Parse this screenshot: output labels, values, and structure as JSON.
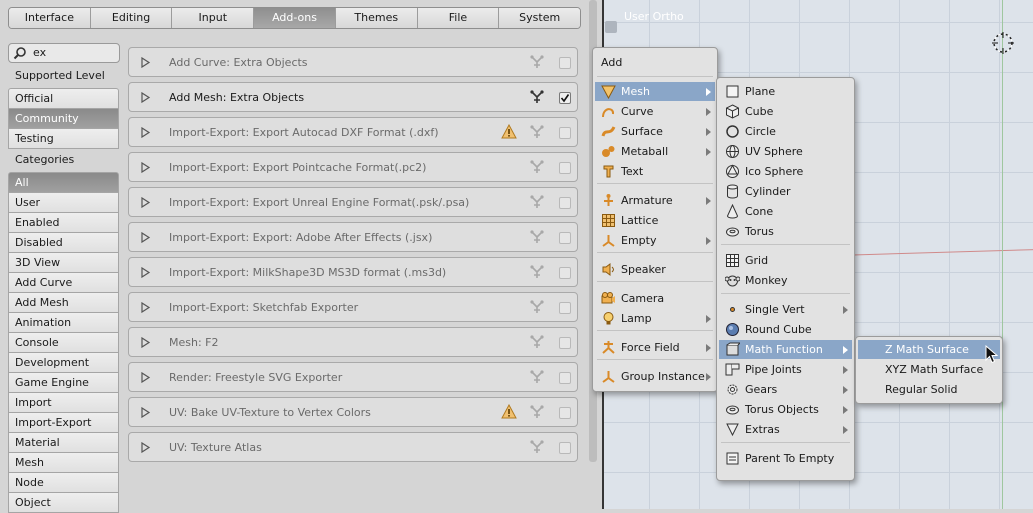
{
  "tabs": [
    "Interface",
    "Editing",
    "Input",
    "Add-ons",
    "Themes",
    "File",
    "System"
  ],
  "active_tab": "Add-ons",
  "search": {
    "value": "ex"
  },
  "supported_level": {
    "label": "Supported Level",
    "items": [
      "Official",
      "Community",
      "Testing"
    ],
    "selected": "Community"
  },
  "categories": {
    "label": "Categories",
    "items": [
      "All",
      "User",
      "Enabled",
      "Disabled",
      "3D View",
      "Add Curve",
      "Add Mesh",
      "Animation",
      "Console",
      "Development",
      "Game Engine",
      "Import",
      "Import-Export",
      "Material",
      "Mesh",
      "Node",
      "Object"
    ],
    "selected": "All"
  },
  "addons": [
    {
      "name": "Add Curve: Extra Objects",
      "enabled": false,
      "warning": false
    },
    {
      "name": "Add Mesh: Extra Objects",
      "enabled": true,
      "warning": false
    },
    {
      "name": "Import-Export: Export Autocad DXF Format (.dxf)",
      "enabled": false,
      "warning": true
    },
    {
      "name": "Import-Export: Export Pointcache Format(.pc2)",
      "enabled": false,
      "warning": false
    },
    {
      "name": "Import-Export: Export Unreal Engine Format(.psk/.psa)",
      "enabled": false,
      "warning": false
    },
    {
      "name": "Import-Export: Export: Adobe After Effects (.jsx)",
      "enabled": false,
      "warning": false
    },
    {
      "name": "Import-Export: MilkShape3D MS3D format (.ms3d)",
      "enabled": false,
      "warning": false
    },
    {
      "name": "Import-Export: Sketchfab Exporter",
      "enabled": false,
      "warning": false
    },
    {
      "name": "Mesh: F2",
      "enabled": false,
      "warning": false
    },
    {
      "name": "Render: Freestyle SVG Exporter",
      "enabled": false,
      "warning": false
    },
    {
      "name": "UV: Bake UV-Texture to Vertex Colors",
      "enabled": false,
      "warning": true
    },
    {
      "name": "UV: Texture Atlas",
      "enabled": false,
      "warning": false
    }
  ],
  "viewport": {
    "title": "User Ortho"
  },
  "add_menu": {
    "title": "Add",
    "items": [
      {
        "label": "Mesh",
        "icon": "mesh-icon",
        "submenu": true,
        "highlight": true
      },
      {
        "label": "Curve",
        "icon": "curve-icon",
        "submenu": true
      },
      {
        "label": "Surface",
        "icon": "surface-icon",
        "submenu": true
      },
      {
        "label": "Metaball",
        "icon": "metaball-icon",
        "submenu": true
      },
      {
        "label": "Text",
        "icon": "text-icon",
        "submenu": false
      },
      {
        "label": "Armature",
        "icon": "armature-icon",
        "submenu": true
      },
      {
        "label": "Lattice",
        "icon": "lattice-icon",
        "submenu": false
      },
      {
        "label": "Empty",
        "icon": "empty-icon",
        "submenu": true
      },
      {
        "label": "Speaker",
        "icon": "speaker-icon",
        "submenu": false
      },
      {
        "label": "Camera",
        "icon": "camera-icon",
        "submenu": false
      },
      {
        "label": "Lamp",
        "icon": "lamp-icon",
        "submenu": true
      },
      {
        "label": "Force Field",
        "icon": "force-field-icon",
        "submenu": true
      },
      {
        "label": "Group Instance",
        "icon": "group-instance-icon",
        "submenu": true
      }
    ]
  },
  "mesh_menu": {
    "items": [
      {
        "label": "Plane",
        "icon": "plane-icon"
      },
      {
        "label": "Cube",
        "icon": "cube-icon"
      },
      {
        "label": "Circle",
        "icon": "circle-icon"
      },
      {
        "label": "UV Sphere",
        "icon": "uv-sphere-icon"
      },
      {
        "label": "Ico Sphere",
        "icon": "ico-sphere-icon"
      },
      {
        "label": "Cylinder",
        "icon": "cylinder-icon"
      },
      {
        "label": "Cone",
        "icon": "cone-icon"
      },
      {
        "label": "Torus",
        "icon": "torus-icon"
      },
      {
        "label": "Grid",
        "icon": "grid-icon"
      },
      {
        "label": "Monkey",
        "icon": "monkey-icon"
      },
      {
        "label": "Single Vert",
        "icon": "vertex-icon",
        "submenu": true
      },
      {
        "label": "Round Cube",
        "icon": "round-cube-icon"
      },
      {
        "label": "Math Function",
        "icon": "math-function-icon",
        "submenu": true,
        "highlight": true
      },
      {
        "label": "Pipe Joints",
        "icon": "pipe-joints-icon",
        "submenu": true
      },
      {
        "label": "Gears",
        "icon": "gears-icon",
        "submenu": true
      },
      {
        "label": "Torus Objects",
        "icon": "torus-objects-icon",
        "submenu": true
      },
      {
        "label": "Extras",
        "icon": "extras-icon",
        "submenu": true
      },
      {
        "label": "Parent To Empty",
        "icon": "parent-icon"
      }
    ]
  },
  "math_menu": {
    "items": [
      {
        "label": "Z Math Surface",
        "highlight": true
      },
      {
        "label": "XYZ Math Surface"
      },
      {
        "label": "Regular Solid"
      }
    ]
  }
}
